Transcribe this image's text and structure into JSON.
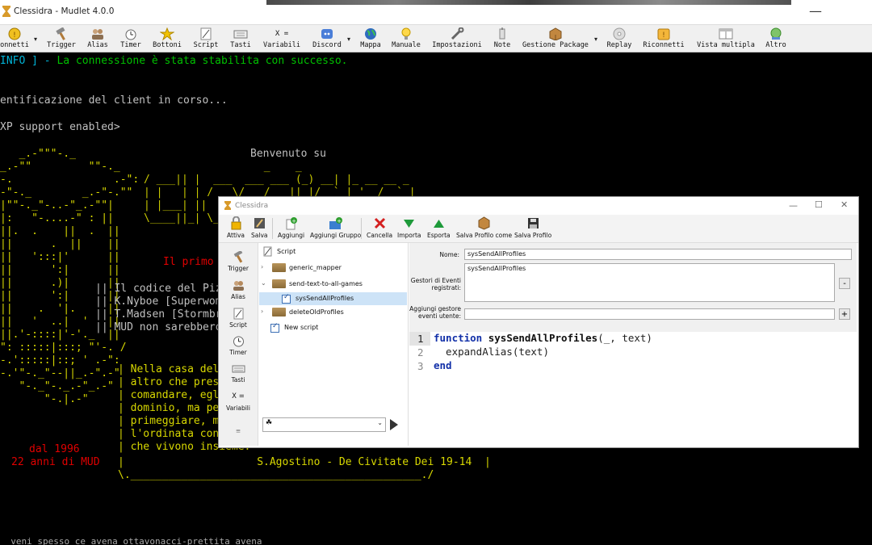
{
  "window": {
    "title": "Clessidra - Mudlet 4.0.0"
  },
  "toolbar": {
    "items": [
      {
        "label": "onnetti"
      },
      {
        "label": "Trigger"
      },
      {
        "label": "Alias"
      },
      {
        "label": "Timer"
      },
      {
        "label": "Bottoni"
      },
      {
        "label": "Script"
      },
      {
        "label": "Tasti"
      },
      {
        "label": "Variabili"
      },
      {
        "label": "Discord"
      },
      {
        "label": "Mappa"
      },
      {
        "label": "Manuale"
      },
      {
        "label": "Impostazioni"
      },
      {
        "label": "Note"
      },
      {
        "label": "Gestione Package"
      },
      {
        "label": "Replay"
      },
      {
        "label": "Riconnetti"
      },
      {
        "label": "Vista multipla"
      },
      {
        "label": "Altro"
      }
    ],
    "variabili_glyph": "X ="
  },
  "console": {
    "info_prefix": "INFO ] - ",
    "info_msg": "La connessione è stata stabilita con successo.",
    "line_auth": "entificazione del client in corso...",
    "line_gmcp": "XP support enabled>",
    "welcome": "Benvenuto su",
    "art_1": "   _.-\"\"\"-._",
    "art_2": "_.-\"\"         \"\"-._",
    "art_3": "-.                .-\":",
    "art_4": "-\"-._        _.-\"-.\"\"",
    "art_5": "|\"\"-._\"-..-\"_.-\"\"|",
    "art_6": "|:   \"-....-\" : ||",
    "art_7": "||.  .    ||  .  ||",
    "art_8": "||      .  ||    ||",
    "art_9": "||   ':::|'      ||",
    "art_10": "||      ':|      ||",
    "art_11": "||      .)|      ||",
    "art_12": "||      ':|      ||",
    "art_13": "||    .  '|.     ||",
    "art_14": "||   '  ..|  '   ||",
    "art_15": "||.'-::::|'-'._  ||",
    "art_16": "\": :::::|:::; \"'-. /",
    "art_17": "-.':::::|::; ' .-\":",
    "art_18": "-.'\"-._\"--||_.-\".-\"",
    "art_19": "   \"-._\"-._.-\"_.-\"",
    "art_20": "       \"-.|.-\"",
    "logo_1": "                   _    _",
    "logo_2": "/ ___|| |  ___  ___ ___ (_) __| |_ __ __ _",
    "logo_3": "| |   | | / _ \\/ __/ __|| |/ _` | '__/ _` |",
    "logo_4": "| |___| ||  __/\\__ \\__ \\| | (_| | | | (_| |",
    "logo_5": "\\____||_| \\___||___/___/|_|\\__,_|_|  \\__,_|",
    "red_line": "Il primo M",
    "text_1": "Il codice del Pizza",
    "text_2": "K.Nyboe [Superwoman",
    "text_3": "T.Madsen [Stormbrin",
    "text_4": "MUD non sarebbero e",
    "quote_1": "Nella casa del g",
    "quote_2": "altro che presta",
    "quote_3": "comandare, egli",
    "quote_4": "dominio, ma per",
    "quote_5": "primeggiare, ma",
    "quote_6": "l'ordinata conco",
    "quote_7": "che vivono insieme.",
    "quote_author": "S.Agostino - De Civitate Dei 19-14",
    "since_1": "dal 1996",
    "since_2": "22 anni di MUD",
    "bottom_cut": "  veni spesso ce avena ottavonacci-prettita avena"
  },
  "dialog": {
    "title": "Clessidra",
    "toolbar": [
      {
        "label": "Attiva"
      },
      {
        "label": "Salva"
      },
      {
        "label": "Aggiungi"
      },
      {
        "label": "Aggiungi Gruppo"
      },
      {
        "label": "Cancella"
      },
      {
        "label": "Importa"
      },
      {
        "label": "Esporta"
      },
      {
        "label": "Salva Profilo come"
      },
      {
        "label": "Salva Profilo"
      }
    ],
    "sidebar": [
      {
        "label": "Trigger"
      },
      {
        "label": "Alias"
      },
      {
        "label": "Script"
      },
      {
        "label": "Timer"
      },
      {
        "label": "Tasti"
      },
      {
        "label": "Variabili"
      }
    ],
    "tree": {
      "root": "Script",
      "items": [
        "generic_mapper",
        "send-text-to-all-games",
        "sysSendAllProfiles",
        "deleteOldProfiles",
        "New script"
      ]
    },
    "props": {
      "name_label": "Nome:",
      "name_value": "sysSendAllProfiles",
      "handlers_label_1": "Gestori di Eventi",
      "handlers_label_2": "registrati:",
      "handlers_value": "sysSendAllProfiles",
      "add_label_1": "Aggiungi gestore",
      "add_label_2": "eventi utente:",
      "add_value": "",
      "minus": "-",
      "plus": "+"
    },
    "editor": {
      "line_numbers": [
        "1",
        "2",
        "3"
      ],
      "line1_kw": "function",
      "line1_fn": "sysSendAllProfiles",
      "line1_rest": "(_, text)",
      "line2": "  expandAlias(text)",
      "line3_kw": "end"
    }
  }
}
